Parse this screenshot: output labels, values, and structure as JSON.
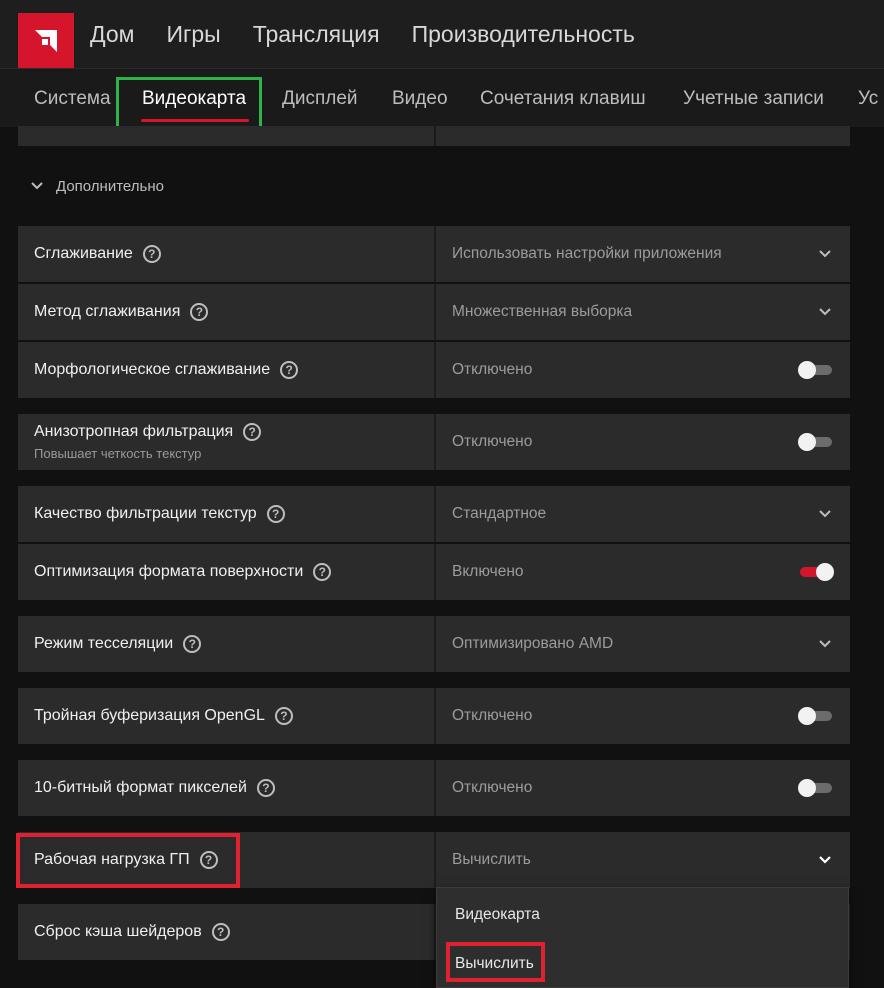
{
  "topnav": [
    "Дом",
    "Игры",
    "Трансляция",
    "Производительность"
  ],
  "subnav": [
    "Система",
    "Видеокарта",
    "Дисплей",
    "Видео",
    "Сочетания клавиш",
    "Учетные записи",
    "Ус"
  ],
  "section": {
    "title": "Дополнительно"
  },
  "rows": [
    {
      "label": "Сглаживание",
      "value": "Использовать настройки приложения",
      "control": "dropdown"
    },
    {
      "label": "Метод сглаживания",
      "value": "Множественная выборка",
      "control": "dropdown"
    },
    {
      "label": "Морфологическое сглаживание",
      "value": "Отключено",
      "control": "toggle-off"
    },
    {
      "label": "Анизотропная фильтрация",
      "sublabel": "Повышает четкость текстур",
      "value": "Отключено",
      "control": "toggle-off"
    },
    {
      "label": "Качество фильтрации текстур",
      "value": "Стандартное",
      "control": "dropdown"
    },
    {
      "label": "Оптимизация формата поверхности",
      "value": "Включено",
      "control": "toggle-on"
    },
    {
      "label": "Режим тесселяции",
      "value": "Оптимизировано AMD",
      "control": "dropdown"
    },
    {
      "label": "Тройная буферизация OpenGL",
      "value": "Отключено",
      "control": "toggle-off"
    },
    {
      "label": "10-битный формат пикселей",
      "value": "Отключено",
      "control": "toggle-off"
    },
    {
      "label": "Рабочая нагрузка ГП",
      "value": "Вычислить",
      "control": "dropdown"
    },
    {
      "label": "Сброс кэша шейдеров"
    }
  ],
  "dropdown_options": [
    "Видеокарта",
    "Вычислить"
  ],
  "colors": {
    "accent": "#d4152b",
    "highlight_green": "#2fb24a",
    "highlight_red": "#de2232"
  }
}
